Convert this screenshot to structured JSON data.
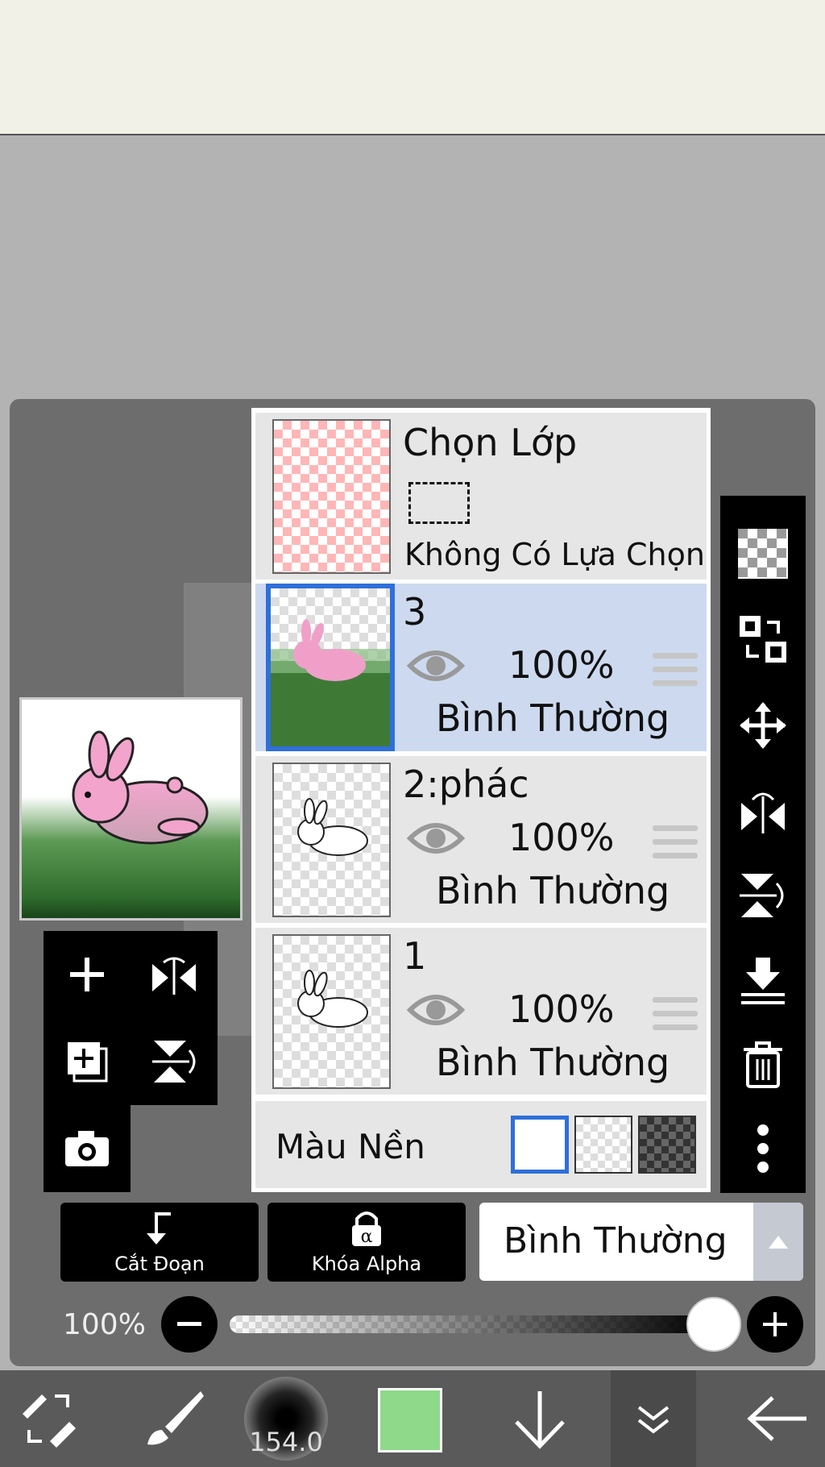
{
  "selection_layer": {
    "title": "Chọn Lớp",
    "status": "Không Có Lựa Chọn"
  },
  "layers": [
    {
      "name": "3",
      "opacity": "100%",
      "blend": "Bình Thường",
      "selected": true
    },
    {
      "name": "2:phác",
      "opacity": "100%",
      "blend": "Bình Thường",
      "selected": false
    },
    {
      "name": "1",
      "opacity": "100%",
      "blend": "Bình Thường",
      "selected": false
    }
  ],
  "background": {
    "label": "Màu Nền",
    "options": [
      "white",
      "transparent",
      "dark-checker"
    ],
    "selected": "white"
  },
  "bottom_buttons": {
    "clipping": "Cắt Đoạn",
    "alpha_lock": "Khóa Alpha"
  },
  "blend_mode": {
    "value": "Bình Thường"
  },
  "opacity_slider": {
    "label": "100%",
    "value": 100
  },
  "brush_size": "154.0",
  "colors": {
    "current_color": "#8ed98a",
    "selection_blue": "#2e6fd9",
    "selected_row": "#cdd9ee"
  },
  "right_tools": [
    "transparency-icon",
    "copy-move-icon",
    "move-icon",
    "flip-horizontal-icon",
    "flip-vertical-icon",
    "merge-down-icon",
    "trash-icon",
    "more-icon"
  ],
  "left_tools": [
    "add-layer-icon",
    "flip-horizontal-icon",
    "duplicate-layer-icon",
    "flip-vertical-icon",
    "camera-icon"
  ],
  "bottom_bar_tools": [
    "swap-tool-icon",
    "brush-icon",
    "brush-size",
    "color-swatch",
    "move-down-icon",
    "collapse-icon",
    "back-icon"
  ]
}
